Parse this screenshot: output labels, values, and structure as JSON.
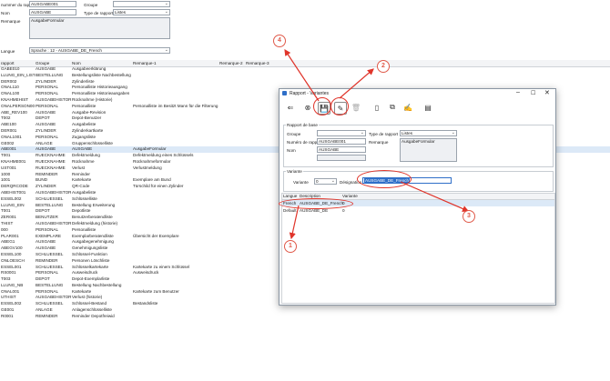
{
  "top_form": {
    "nummer_label": "nummer du rapp",
    "nummer_value": "AUSGABE001",
    "gruppe_label": "Groupe",
    "gruppe_value": "",
    "name_label": "Nom",
    "name_value": "AUSGABE",
    "typ_label": "Type de rapport",
    "typ_value": "Listes",
    "bemerkung_label": "Remarque",
    "bemerkung_value": "AusgabeFormular",
    "sprache_label": "Langue",
    "sprache_value": "Sprache : 12 - AUSGABE_DE_French"
  },
  "table": {
    "headers": [
      "rapport",
      "Groupe",
      "Nom",
      "Remarque-1",
      "Remarque-2",
      "Remarque-3"
    ],
    "rows": [
      [
        "GABE010",
        "AUSGABE",
        "Ausgabeerklärung",
        ""
      ],
      [
        "LLUNG_EIN_LISTE",
        "BESTELLUNG",
        "Bestellungsliste Nachbestellung",
        ""
      ],
      [
        "DER002",
        "ZYLINDER",
        "Zylinderliste",
        ""
      ],
      [
        "ONAL110",
        "PERSONAL",
        "Personalliste Historieausgang",
        ""
      ],
      [
        "ONAL100",
        "PERSONAL",
        "Personalliste Historieausgaben",
        ""
      ],
      [
        "KNAHMEHIST",
        "AUSGABEHISTORIE",
        "Rücknahme (Historie)",
        ""
      ],
      [
        "ONALPERSON001",
        "PERSONAL",
        "Personalliste",
        "Personalliste im Besitzt Mann für die Filterung"
      ],
      [
        "ABE_REV100",
        "AUSGABE",
        "Ausgabe-Revision",
        ""
      ],
      [
        "T002",
        "DEPOT",
        "Depot-Benutzer",
        ""
      ],
      [
        "ABE100",
        "AUSGABE",
        "Ausgabeliste",
        ""
      ],
      [
        "DER001",
        "ZYLINDER",
        "Zylinderkartkarte",
        ""
      ],
      [
        "ONAL1001",
        "PERSONAL",
        "Zugangsliste",
        ""
      ],
      [
        "GE002",
        "ANLAGE",
        "Gruppenschlüsselliste",
        ""
      ],
      [
        "ABE001",
        "AUSGABE",
        "AUSGABE",
        "AusgabeFormular"
      ],
      [
        "T001",
        "RUECKNAHME",
        "Defektmeldung",
        "Defektmeldung eines Schlüssels"
      ],
      [
        "KNAHME001",
        "RUECKNAHME",
        "Rücknahme",
        "Rücknahmeformular"
      ],
      [
        "UST001",
        "RUECKNAHME",
        "Verlust",
        "Verlustmeldung"
      ],
      [
        "1000",
        "REMINDER",
        "Reminder",
        ""
      ],
      [
        "1001",
        "BUND",
        "Kartekarte",
        "Exemplare am Bund"
      ],
      [
        "DERQRCODE",
        "ZYLINDER",
        "QR-Code",
        "Türschild für einen Zylinder"
      ],
      [
        "ABEHIST001",
        "AUSGABEHISTORIE",
        "Ausgabeliste",
        ""
      ],
      [
        "ESSEL002",
        "SCHLUESSEL",
        "Schlüsselliste",
        ""
      ],
      [
        "LLUNG_EIN",
        "BESTELLUNG",
        "Bestellung Erweiterung",
        ""
      ],
      [
        "T001",
        "DEPOT",
        "Depotliste",
        ""
      ],
      [
        "ZER001",
        "BENUTZER",
        "Benutzerberatendliste",
        ""
      ],
      [
        "THIST",
        "AUSGABEHISTORIE",
        "Defektmeldung (historie)",
        ""
      ],
      [
        "000",
        "PERSONAL",
        "Personalliste",
        ""
      ],
      [
        "PLAR001",
        "EXEMPLARE",
        "Exemplarberatendliste",
        "Übersicht der Exemplare"
      ],
      [
        "ABEG1",
        "AUSGABE",
        "Ausgabegenehmigung",
        ""
      ],
      [
        "ABEGV100",
        "AUSGABE",
        "Genehmigungsliste",
        ""
      ],
      [
        "ESSEL100",
        "SCHLUESSEL",
        "Schlüssel-Funktion",
        ""
      ],
      [
        "ONLOESCH",
        "REMINDER",
        "Personen Löschliste",
        ""
      ],
      [
        "ESSEL001",
        "SCHLUESSEL",
        "Schlüsselkartekarte",
        "Kartekarte zu einem Schlüssel"
      ],
      [
        "RS0001",
        "PERSONAL",
        "Ausweisdruck",
        "Ausweisdruck"
      ],
      [
        "T003",
        "DEPOT",
        "Depot-Exemplarliste",
        ""
      ],
      [
        "LLUNG_NB",
        "BESTELLUNG",
        "Bestellung Nachbestellung",
        ""
      ],
      [
        "ONAL001",
        "PERSONAL",
        "Kartekarte",
        "Kartekarte zum Benutzer"
      ],
      [
        "UTHIST",
        "AUSGABEHISTORIE",
        "Verlust (historie)",
        ""
      ],
      [
        "ESSEL002",
        "SCHLUESSEL",
        "Schlüssel-Bestand",
        "Bestandsliste"
      ],
      [
        "GE001",
        "ANLAGE",
        "Anlagenschlüsselliste",
        ""
      ],
      [
        "R0001",
        "REMINDER",
        "Reminder Depotfreiwid",
        ""
      ]
    ]
  },
  "dialog": {
    "title": "Rapport - Variantes",
    "basis_legend": "Rapport de base",
    "gruppe_label": "Groupe",
    "gruppe_value": "",
    "typ_label": "Type de rapport",
    "typ_value": "Listes",
    "nummer_label": "Numéro de rapport",
    "nummer_value": "AUSGABE001",
    "bemerkung_label": "Remarque",
    "bemerkung_value": "AusgabeFormular",
    "name_label": "Nom",
    "name_value": "AUSGABE",
    "variante_legend": "Variante",
    "variante_label": "Variante",
    "variante_value": "0",
    "bezeichnung_label": "Désignation",
    "bezeichnung_value": "AUSGABE_DE_French",
    "grid_headers": [
      "Langue",
      "Description",
      "Variante"
    ],
    "grid_rows": [
      [
        "French",
        "AUSGABE_DE_French",
        "0"
      ],
      [
        "Default",
        "AUSGABE_DE",
        "0"
      ]
    ]
  },
  "annotations": [
    "1",
    "2",
    "3",
    "4"
  ],
  "colors": {
    "accent": "#2f6fc8",
    "annotation": "#e0342a",
    "selected_row": "#dce9f7"
  }
}
